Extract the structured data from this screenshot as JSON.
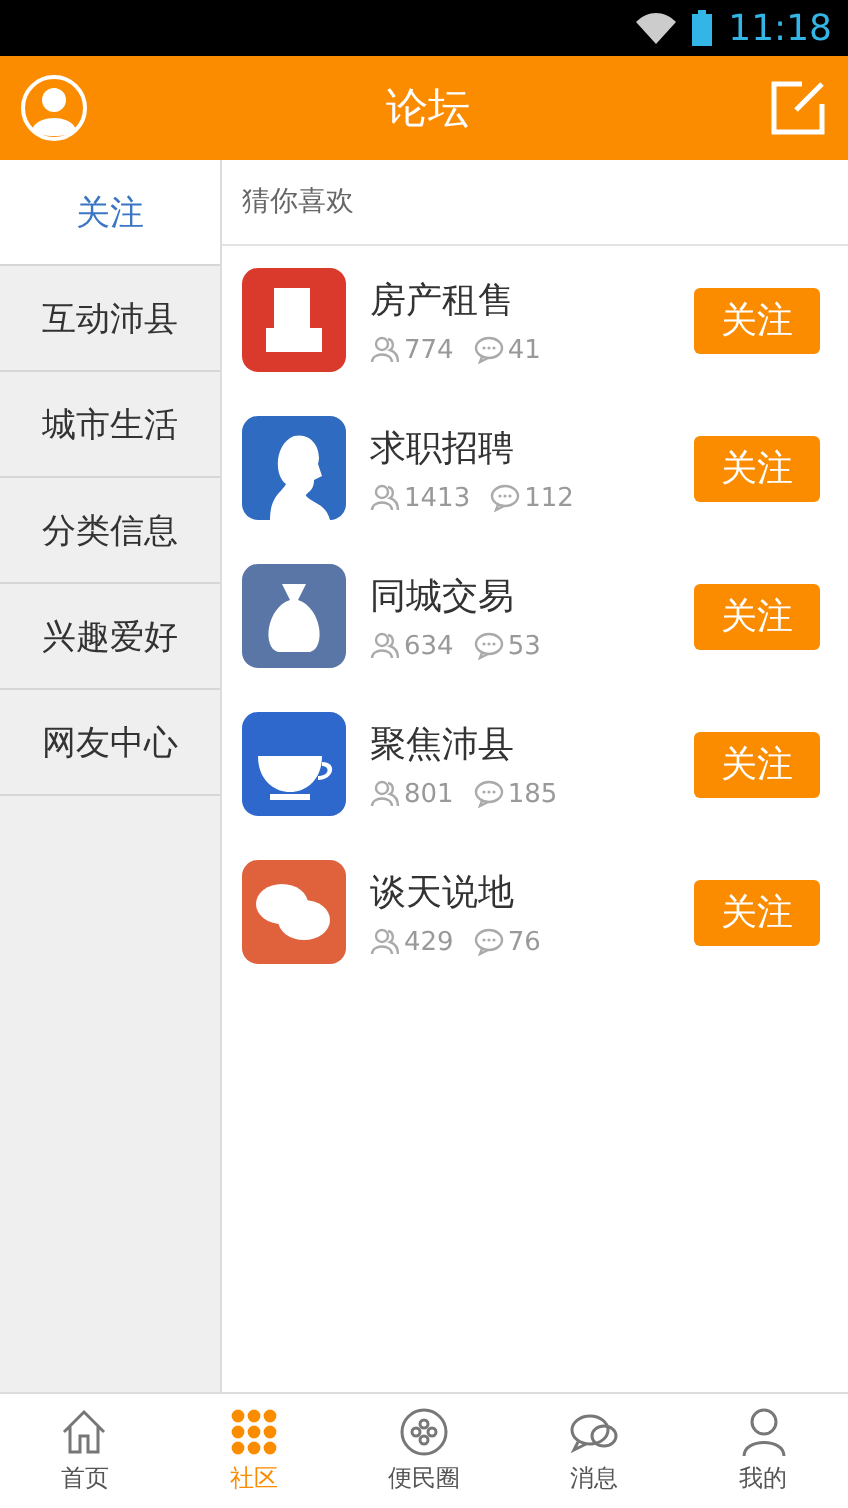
{
  "status_bar": {
    "time": "11:18"
  },
  "header": {
    "title": "论坛"
  },
  "sidebar": {
    "items": [
      {
        "label": "关注",
        "selected": true
      },
      {
        "label": "互动沛县",
        "selected": false
      },
      {
        "label": "城市生活",
        "selected": false
      },
      {
        "label": "分类信息",
        "selected": false
      },
      {
        "label": "兴趣爱好",
        "selected": false
      },
      {
        "label": "网友中心",
        "selected": false
      }
    ]
  },
  "section_title": "猜你喜欢",
  "forums": [
    {
      "name": "房产租售",
      "members": "774",
      "posts": "41",
      "color": "#d93a2c",
      "button": "关注"
    },
    {
      "name": "求职招聘",
      "members": "1413",
      "posts": "112",
      "color": "#2f6bc0",
      "button": "关注"
    },
    {
      "name": "同城交易",
      "members": "634",
      "posts": "53",
      "color": "#5a76a6",
      "button": "关注"
    },
    {
      "name": "聚焦沛县",
      "members": "801",
      "posts": "185",
      "color": "#2f68cc",
      "button": "关注"
    },
    {
      "name": "谈天说地",
      "members": "429",
      "posts": "76",
      "color": "#e0623c",
      "button": "关注"
    }
  ],
  "tab_bar": [
    {
      "label": "首页",
      "selected": false
    },
    {
      "label": "社区",
      "selected": true
    },
    {
      "label": "便民圈",
      "selected": false
    },
    {
      "label": "消息",
      "selected": false
    },
    {
      "label": "我的",
      "selected": false
    }
  ]
}
